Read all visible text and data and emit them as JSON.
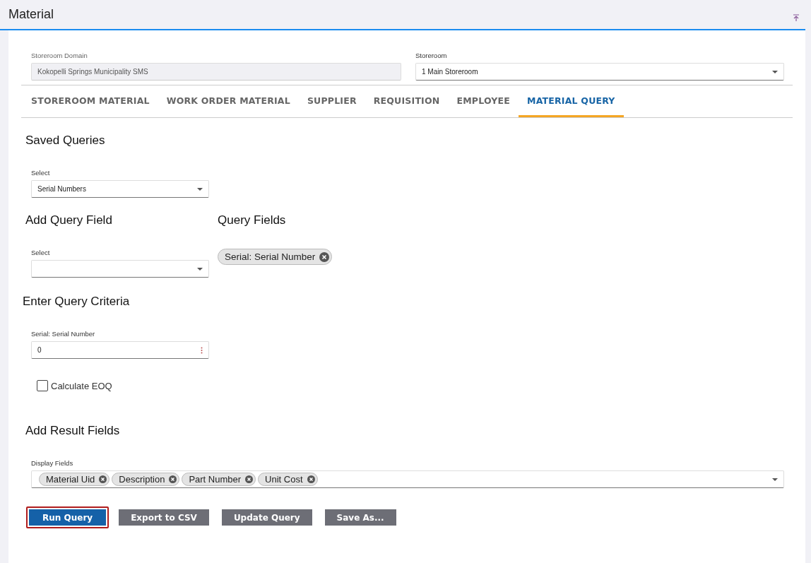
{
  "header": {
    "title": "Material"
  },
  "storeroom_domain": {
    "label": "Storeroom Domain",
    "value": "Kokopelli Springs Municipality SMS",
    "disabled": true
  },
  "storeroom": {
    "label": "Storeroom",
    "value": "1 Main Storeroom"
  },
  "tabs": [
    {
      "label": "STOREROOM MATERIAL",
      "selected": false
    },
    {
      "label": "WORK ORDER MATERIAL",
      "selected": false
    },
    {
      "label": "SUPPLIER",
      "selected": false
    },
    {
      "label": "REQUISITION",
      "selected": false
    },
    {
      "label": "EMPLOYEE",
      "selected": false
    },
    {
      "label": "MATERIAL QUERY",
      "selected": true
    }
  ],
  "saved_queries": {
    "heading": "Saved Queries",
    "label": "Select",
    "value": "Serial Numbers"
  },
  "add_query_field": {
    "heading": "Add Query Field",
    "label": "Select"
  },
  "query_fields": {
    "heading": "Query Fields",
    "chips": [
      "Serial: Serial Number"
    ]
  },
  "criteria": {
    "heading": "Enter Query Criteria",
    "fields": [
      {
        "label": "Serial: Serial Number",
        "value": "0"
      }
    ]
  },
  "calculate_eoq": {
    "label": "Calculate EOQ",
    "checked": false
  },
  "result_fields": {
    "heading": "Add Result Fields",
    "label": "Display Fields",
    "chips": [
      "Material Uid",
      "Description",
      "Part Number",
      "Unit Cost"
    ]
  },
  "buttons": [
    {
      "label": "Run Query",
      "kind": "primary",
      "focused": true
    },
    {
      "label": "Export to CSV",
      "kind": "secondary",
      "focused": false
    },
    {
      "label": "Update Query",
      "kind": "secondary",
      "focused": false
    },
    {
      "label": "Save As...",
      "kind": "secondary",
      "focused": false
    }
  ]
}
